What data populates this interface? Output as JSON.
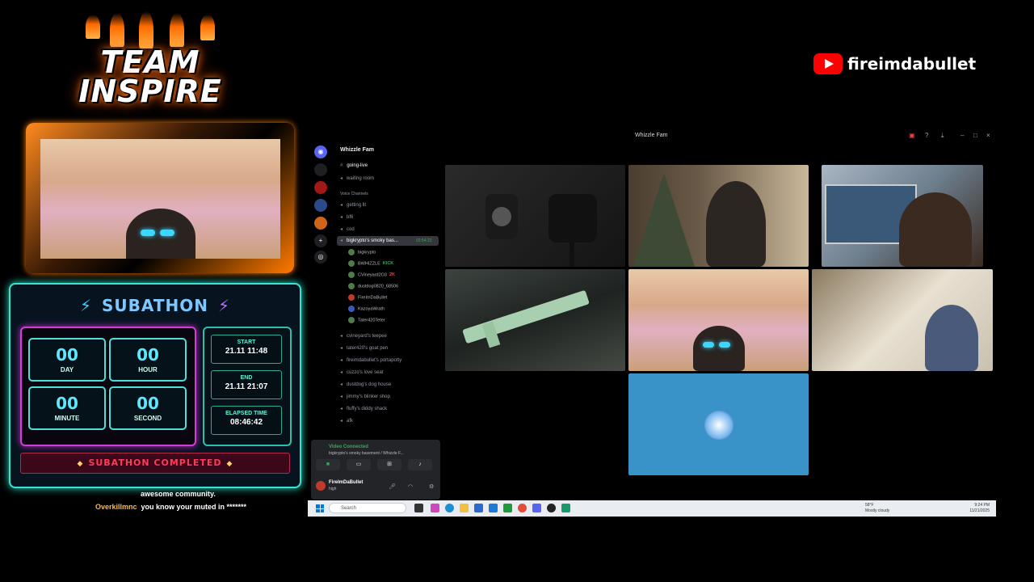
{
  "branding": {
    "team_logo": [
      "TEAM",
      "INSPIRE"
    ],
    "channel_name": "fireimdabullet"
  },
  "subathon": {
    "title": "SUBATHON",
    "timer": [
      {
        "value": "00",
        "label": "DAY"
      },
      {
        "value": "00",
        "label": "HOUR"
      },
      {
        "value": "00",
        "label": "MINUTE"
      },
      {
        "value": "00",
        "label": "SECOND"
      }
    ],
    "start": {
      "label": "START",
      "value": "21.11 11:48"
    },
    "end": {
      "label": "END",
      "value": "21.11 21:07"
    },
    "elapsed": {
      "label": "ELAPSED TIME",
      "value": "08:46:42"
    },
    "status": "SUBATHON COMPLETED"
  },
  "chat": [
    {
      "user": "",
      "message": "awesome community."
    },
    {
      "user": "Overkillmnc",
      "message": "you know your muted in *******"
    }
  ],
  "discord": {
    "window_title": "Whizzle Fam",
    "server_name": "Whizzle Fam",
    "text_channels": [
      "going-live",
      "waiting room"
    ],
    "voice_header": "Voice Channels",
    "voice_channels_top": [
      "getting lit",
      "bf6",
      "cod"
    ],
    "active_channel": {
      "name": "bigkrypto's smoky bas...",
      "time": "02:54:23"
    },
    "voice_users": [
      {
        "name": "bigkrypto",
        "tag": ""
      },
      {
        "name": "BWHIZZLE",
        "tag": "KICK"
      },
      {
        "name": "CVineyard2O3",
        "tag": "2K"
      },
      {
        "name": "dustdog0820_68506",
        "tag": ""
      },
      {
        "name": "FireImDaBullet",
        "tag": ""
      },
      {
        "name": "KazoyaWrath",
        "tag": ""
      },
      {
        "name": "Tater420Teter",
        "tag": ""
      }
    ],
    "voice_channels_bottom": [
      "cvineyard's teepee",
      "tater420's goat pen",
      "fireimdabullet's portapotty",
      "cuzzo's love seat",
      "dustdog's dog house",
      "jimmy's blinker shop",
      "fluffy's diddy shack",
      "afk"
    ],
    "voice_status": {
      "title": "Video Connected",
      "subtitle": "bigkrypto's smoky basement / Whizzle F..."
    },
    "user_panel": {
      "name": "FireImDaBullet",
      "status": "high"
    }
  },
  "taskbar": {
    "search_placeholder": "Search",
    "weather_temp": "58°F",
    "weather_desc": "Mostly cloudy",
    "time": "9:24 PM",
    "date": "11/21/2025"
  },
  "colors": {
    "subathon_cyan": "#38e4d0",
    "subathon_magenta": "#d23dd5",
    "completed_red": "#ff3a5a",
    "discord_green": "#3ba55c",
    "youtube_red": "#ff0000"
  },
  "icons": [
    "discord-icon",
    "youtube-icon",
    "lightning-icon",
    "hashtag-icon",
    "speaker-icon",
    "windows-icon",
    "search-icon",
    "mic-icon",
    "headphones-icon",
    "gear-icon"
  ]
}
